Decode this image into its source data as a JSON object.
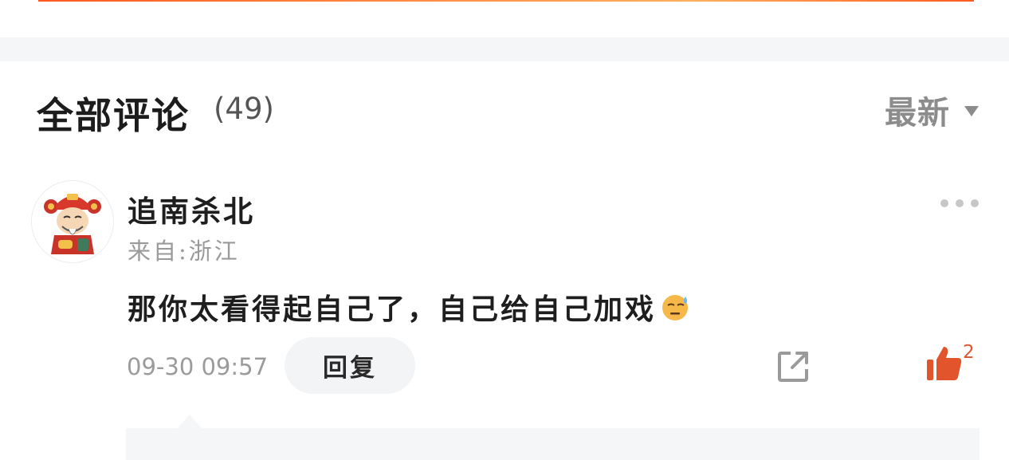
{
  "colors": {
    "accent": "#e2542b",
    "divider": "#f5f6f8",
    "muted": "#9b9b9b"
  },
  "comments_section": {
    "title": "全部评论",
    "count": "(49)",
    "sort": {
      "label": "最新",
      "icon": "caret-down-icon"
    }
  },
  "comment": {
    "avatar": "god-of-wealth-avatar",
    "username": "追南杀北",
    "location": "来自:浙江",
    "text": "那你太看得起自己了，自己给自己加戏",
    "emoji": "sweat-face-emoji",
    "timestamp": "09-30 09:57",
    "reply_label": "回复",
    "share_icon": "share-icon",
    "like_icon": "thumbs-up-icon",
    "like_count": "2",
    "more_icon": "more-dots-icon"
  }
}
